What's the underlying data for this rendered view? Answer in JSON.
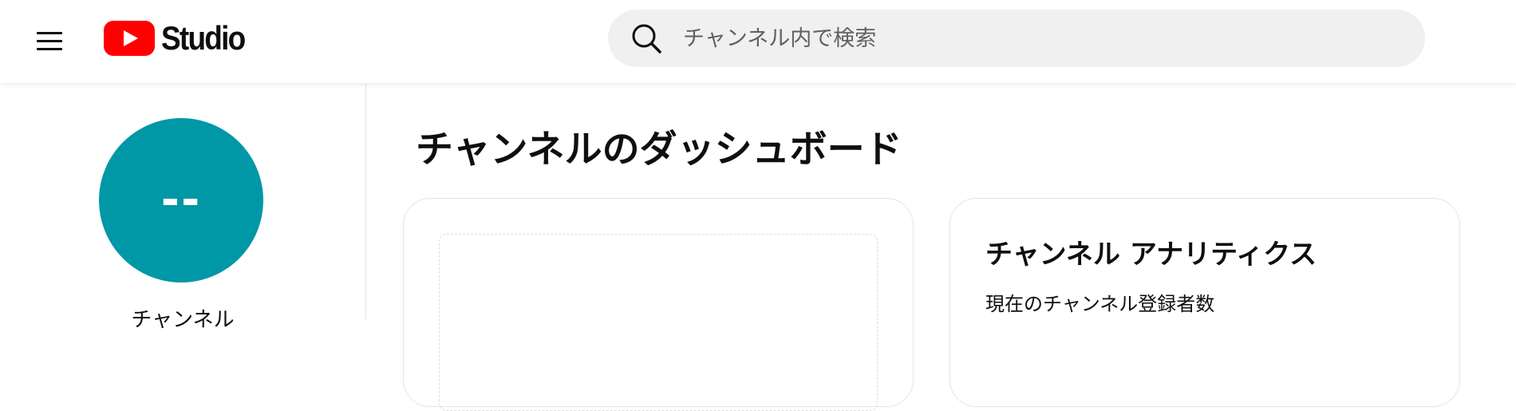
{
  "header": {
    "logo_text": "Studio",
    "search": {
      "placeholder": "チャンネル内で検索"
    }
  },
  "sidebar": {
    "avatar_text": "--",
    "channel_label": "チャンネル"
  },
  "main": {
    "title": "チャンネルのダッシュボード",
    "analytics_card": {
      "title": "チャンネル アナリティクス",
      "subtitle": "現在のチャンネル登録者数"
    }
  },
  "colors": {
    "brand_red": "#ff0000",
    "avatar_bg": "#0097a7",
    "search_bg": "#f0f0f0"
  },
  "icons": {
    "menu": "hamburger-menu-icon",
    "logo": "youtube-play-icon",
    "search": "search-icon"
  }
}
